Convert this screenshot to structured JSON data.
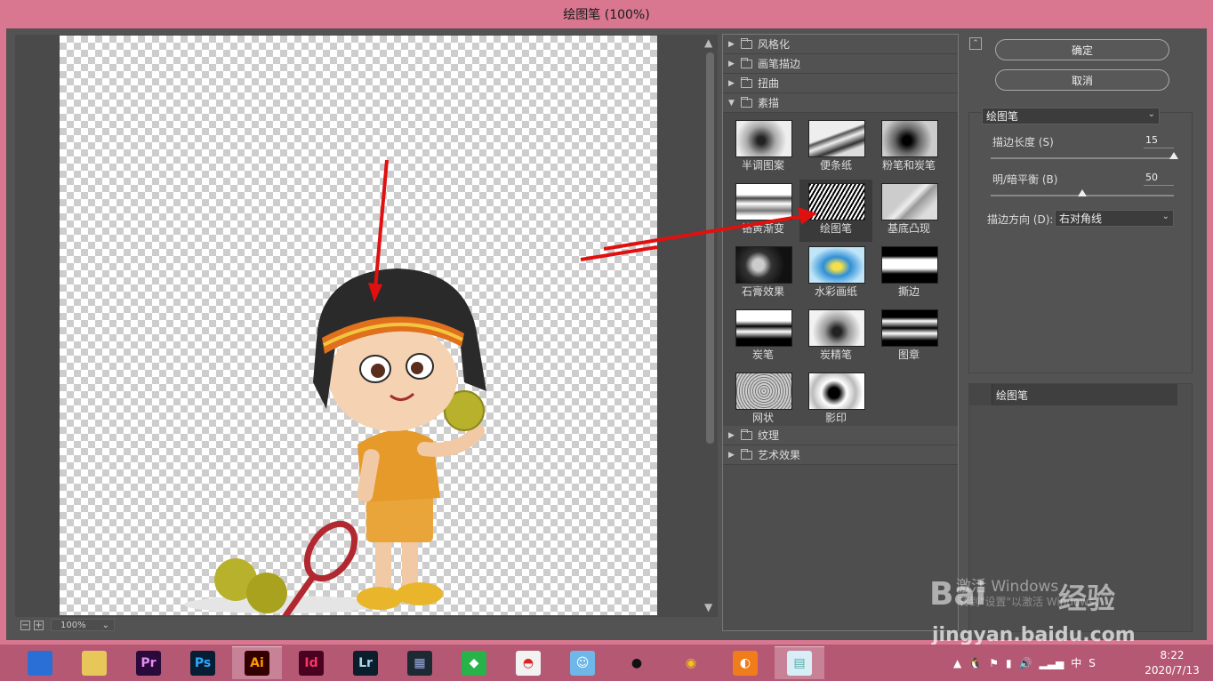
{
  "window": {
    "title": "绘图笔 (100%)"
  },
  "preview": {
    "zoom": "100%"
  },
  "gallery": {
    "folders_top": [
      {
        "label": "风格化",
        "expanded": false
      },
      {
        "label": "画笔描边",
        "expanded": false
      },
      {
        "label": "扭曲",
        "expanded": false
      },
      {
        "label": "素描",
        "expanded": true
      }
    ],
    "filters": [
      {
        "label": "半调图案"
      },
      {
        "label": "便条纸"
      },
      {
        "label": "粉笔和炭笔"
      },
      {
        "label": "铬黄渐变"
      },
      {
        "label": "绘图笔",
        "selected": true
      },
      {
        "label": "基底凸现"
      },
      {
        "label": "石膏效果"
      },
      {
        "label": "水彩画纸"
      },
      {
        "label": "撕边"
      },
      {
        "label": "炭笔"
      },
      {
        "label": "炭精笔"
      },
      {
        "label": "图章"
      },
      {
        "label": "网状"
      },
      {
        "label": "影印"
      }
    ],
    "folders_bottom": [
      {
        "label": "纹理",
        "expanded": false
      },
      {
        "label": "艺术效果",
        "expanded": false
      }
    ]
  },
  "buttons": {
    "ok": "确定",
    "cancel": "取消"
  },
  "settings": {
    "filter_select": "绘图笔",
    "stroke_length": {
      "label": "描边长度 (S)",
      "value": "15",
      "fraction": 1.0
    },
    "light_dark_balance": {
      "label": "明/暗平衡 (B)",
      "value": "50",
      "fraction": 0.5
    },
    "stroke_direction": {
      "label": "描边方向 (D):",
      "value": "右对角线"
    }
  },
  "layers": {
    "item": "绘图笔"
  },
  "watermark": {
    "activate": "激活 Windows",
    "hint": "转到\"设置\"以激活 Windows。",
    "logo": "Bai",
    "logo2": "经验",
    "url": "jingyan.baidu.com"
  },
  "taskbar": {
    "apps": [
      {
        "name": "browser-icon",
        "label": "",
        "bg": "#2a6fd6",
        "fg": "#ffffff"
      },
      {
        "name": "file-explorer-icon",
        "label": "",
        "bg": "#e8c75a",
        "fg": "#ffffff"
      },
      {
        "name": "premiere-icon",
        "label": "Pr",
        "bg": "#2a0a3a",
        "fg": "#e48df3"
      },
      {
        "name": "photoshop-icon",
        "label": "Ps",
        "bg": "#061e33",
        "fg": "#31a8ff"
      },
      {
        "name": "illustrator-icon",
        "label": "Ai",
        "bg": "#330000",
        "fg": "#ff9a00",
        "active": true
      },
      {
        "name": "indesign-icon",
        "label": "Id",
        "bg": "#49021f",
        "fg": "#ff3366"
      },
      {
        "name": "lightroom-icon",
        "label": "Lr",
        "bg": "#0b1e2b",
        "fg": "#add5ec"
      },
      {
        "name": "video-editor-icon",
        "label": "▦",
        "bg": "#1d2a34",
        "fg": "#9ad"
      },
      {
        "name": "green-app-icon",
        "label": "◆",
        "bg": "#27b34a",
        "fg": "#ffffff"
      },
      {
        "name": "umbrella-app-icon",
        "label": "◓",
        "bg": "#f2f2f2",
        "fg": "#d22"
      },
      {
        "name": "cat-app-icon",
        "label": "☺",
        "bg": "#6fb7e8",
        "fg": "#ffffff"
      },
      {
        "name": "qq-icon",
        "label": "●",
        "bg": "#b55874",
        "fg": "#111111"
      },
      {
        "name": "chrome-icon",
        "label": "◉",
        "bg": "#b55874",
        "fg": "#f3c31a"
      },
      {
        "name": "orange-app-icon",
        "label": "◐",
        "bg": "#f07d1a",
        "fg": "#ffffff"
      },
      {
        "name": "notes-app-icon",
        "label": "▤",
        "bg": "#d8eef6",
        "fg": "#5aa",
        "active": true
      }
    ],
    "tray": [
      "▲",
      "🐧",
      "⚑",
      "▮",
      "🔊",
      "▂▃▅",
      "中",
      "S"
    ],
    "time": "8:22",
    "date": "2020/7/13"
  }
}
